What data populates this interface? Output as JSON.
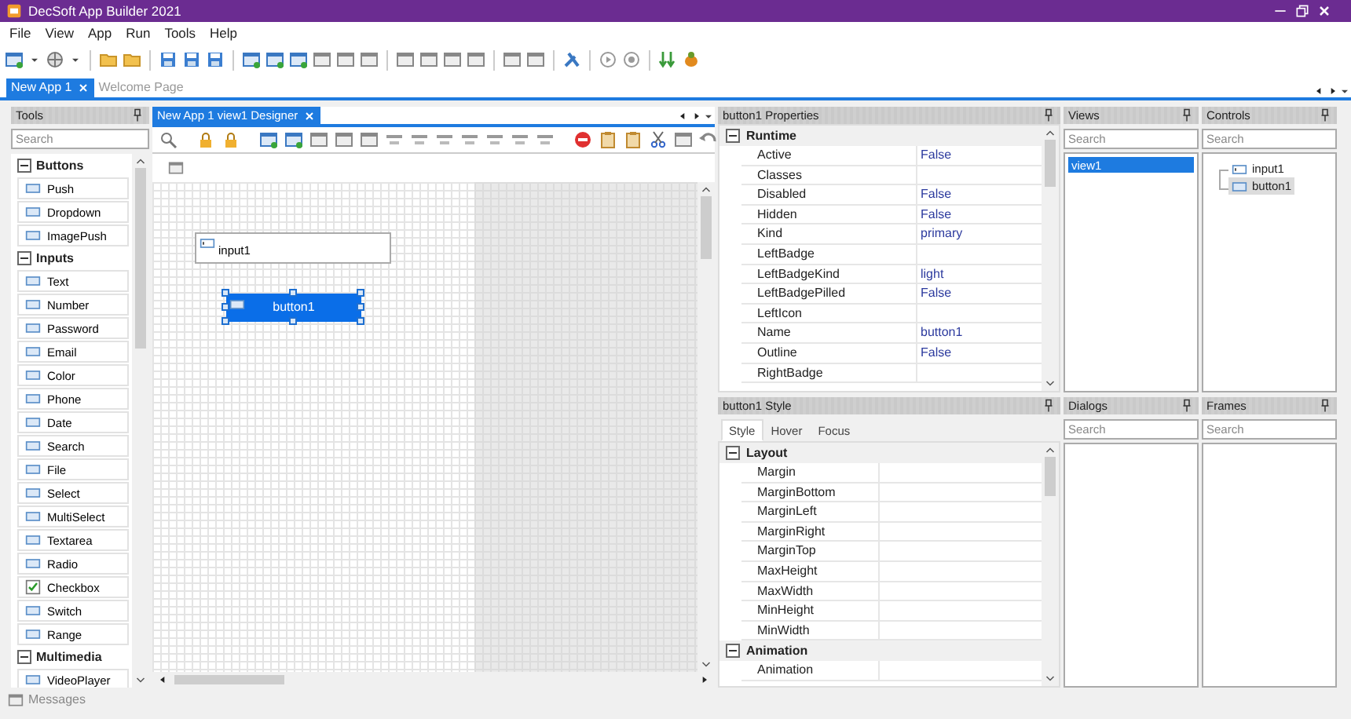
{
  "window": {
    "title": "DecSoft App Builder 2021"
  },
  "menu": [
    "File",
    "View",
    "App",
    "Run",
    "Tools",
    "Help"
  ],
  "document_tabs": [
    {
      "label": "New App 1",
      "selected": true
    },
    {
      "label": "Welcome Page",
      "selected": false
    }
  ],
  "tools_panel": {
    "title": "Tools",
    "search": {
      "placeholder": "Search"
    },
    "groups": [
      {
        "label": "Buttons",
        "expanded": true,
        "items": [
          "Push",
          "Dropdown",
          "ImagePush"
        ]
      },
      {
        "label": "Inputs",
        "expanded": true,
        "items": [
          "Text",
          "Number",
          "Password",
          "Email",
          "Color",
          "Phone",
          "Date",
          "Search",
          "File",
          "Select",
          "MultiSelect",
          "Textarea",
          "Radio",
          "Checkbox",
          "Switch",
          "Range"
        ]
      },
      {
        "label": "Multimedia",
        "expanded": true,
        "items": [
          "VideoPlayer"
        ]
      }
    ]
  },
  "designer": {
    "tab": "New App 1 view1 Designer",
    "controls": [
      {
        "kind": "input",
        "label": "input1",
        "selected": false
      },
      {
        "kind": "button",
        "label": "button1",
        "selected": true
      }
    ]
  },
  "properties": {
    "title": "button1 Properties",
    "groups": [
      {
        "label": "Runtime",
        "expanded": true,
        "rows": [
          {
            "name": "Active",
            "value": "False"
          },
          {
            "name": "Classes"
          },
          {
            "name": "Disabled",
            "value": "False"
          },
          {
            "name": "Hidden",
            "value": "False"
          },
          {
            "name": "Kind",
            "value": "primary"
          },
          {
            "name": "LeftBadge"
          },
          {
            "name": "LeftBadgeKind",
            "value": "light"
          },
          {
            "name": "LeftBadgePilled",
            "value": "False"
          },
          {
            "name": "LeftIcon"
          },
          {
            "name": "Name",
            "value": "button1"
          },
          {
            "name": "Outline",
            "value": "False"
          },
          {
            "name": "RightBadge"
          }
        ]
      }
    ]
  },
  "style_panel": {
    "title": "button1 Style",
    "tabs": [
      {
        "label": "Style",
        "selected": true
      },
      {
        "label": "Hover",
        "selected": false
      },
      {
        "label": "Focus",
        "selected": false
      }
    ],
    "groups": [
      {
        "label": "Layout",
        "expanded": true,
        "rows": [
          "Margin",
          "MarginBottom",
          "MarginLeft",
          "MarginRight",
          "MarginTop",
          "MaxHeight",
          "MaxWidth",
          "MinHeight",
          "MinWidth"
        ]
      },
      {
        "label": "Animation",
        "expanded": true,
        "rows": [
          "Animation"
        ]
      }
    ]
  },
  "views": {
    "title": "Views",
    "search": {
      "placeholder": "Search"
    },
    "items": [
      {
        "label": "view1",
        "selected": true
      }
    ]
  },
  "controls_panel": {
    "title": "Controls",
    "search": {
      "placeholder": "Search"
    },
    "tree": [
      {
        "kind": "input",
        "label": "input1",
        "selected": false
      },
      {
        "kind": "button",
        "label": "button1",
        "selected": true
      }
    ]
  },
  "dialogs": {
    "title": "Dialogs",
    "search": {
      "placeholder": "Search"
    }
  },
  "frames": {
    "title": "Frames",
    "search": {
      "placeholder": "Search"
    }
  },
  "status_bar": {
    "label": "Messages"
  }
}
